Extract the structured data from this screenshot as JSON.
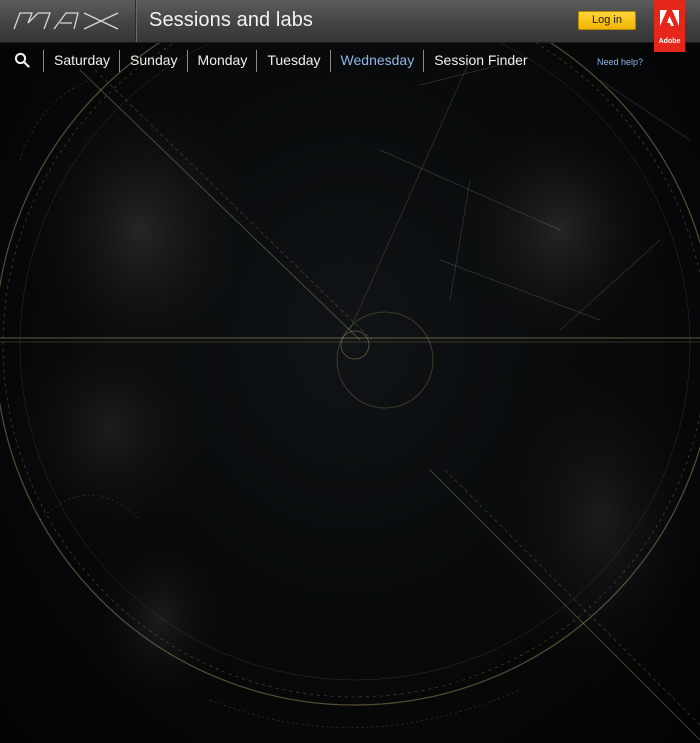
{
  "header": {
    "logo_text": "MAX",
    "title": "Sessions and labs",
    "login_label": "Log in",
    "adobe_label": "Adobe"
  },
  "nav": {
    "search_icon": "search-icon",
    "tabs": [
      {
        "label": "Saturday",
        "active": false
      },
      {
        "label": "Sunday",
        "active": false
      },
      {
        "label": "Monday",
        "active": false
      },
      {
        "label": "Tuesday",
        "active": false
      },
      {
        "label": "Wednesday",
        "active": true
      },
      {
        "label": "Session Finder",
        "active": false
      }
    ],
    "help_label": "Need help?"
  },
  "colors": {
    "header_bg": "#4a4a4a",
    "login_bg": "#f5c518",
    "adobe_red": "#e4271a",
    "active_tab": "#8fb6e8",
    "art_lines": "#b8a46a"
  }
}
